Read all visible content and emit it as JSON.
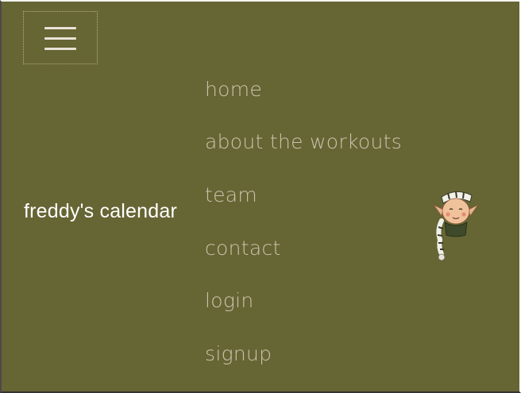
{
  "menu_toggle": {
    "icon": "hamburger-icon"
  },
  "brand": {
    "label": "freddy's calendar"
  },
  "nav": {
    "items": [
      {
        "label": "home"
      },
      {
        "label": "about the workouts"
      },
      {
        "label": "team"
      },
      {
        "label": "contact"
      },
      {
        "label": "login"
      },
      {
        "label": "signup"
      }
    ]
  },
  "mascot": {
    "icon": "elf-mascot-icon"
  },
  "colors": {
    "background": "#666534",
    "nav_text": "#c9c4ad",
    "brand_text": "#ffffff",
    "toggle_bars": "#e8e2d6"
  }
}
